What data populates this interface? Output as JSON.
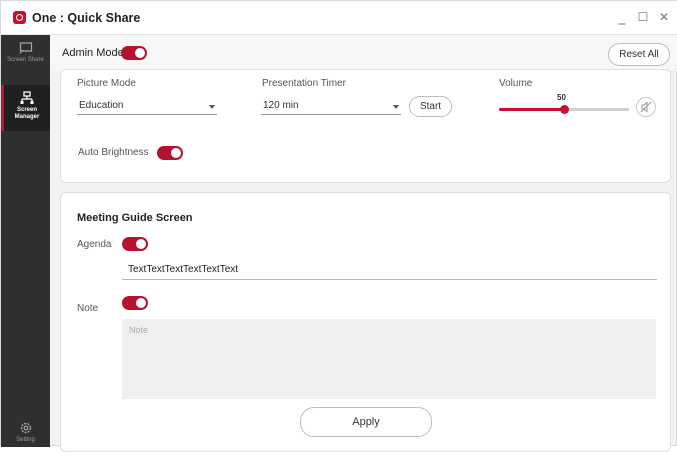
{
  "window": {
    "title": "One : Quick Share",
    "minimize": "_",
    "maximize": "☐",
    "close": "✕"
  },
  "sidebar": {
    "items": [
      {
        "label": "Screen Share",
        "icon": "screen-share-icon"
      },
      {
        "label": "Screen Manager",
        "icon": "network-icon"
      }
    ],
    "bottom": {
      "icon": "settings-icon",
      "label": "Setting"
    }
  },
  "admin": {
    "label": "Admin Mode",
    "enabled": true,
    "reset_label": "Reset All"
  },
  "settings": {
    "picture_mode": {
      "label": "Picture Mode",
      "value": "Education"
    },
    "presentation_timer": {
      "label": "Presentation Timer",
      "value": "120 min",
      "start_label": "Start"
    },
    "volume": {
      "label": "Volume",
      "value": "50",
      "level": 0.5,
      "mute_icon": "mute-icon"
    },
    "auto_brightness": {
      "label": "Auto Brightness",
      "enabled": true
    }
  },
  "meeting_guide": {
    "title": "Meeting Guide Screen",
    "agenda": {
      "label": "Agenda",
      "enabled": true,
      "value": "TextTextTextTextTextText"
    },
    "note": {
      "label": "Note",
      "enabled": true,
      "placeholder": "Note"
    }
  },
  "apply_label": "Apply",
  "colors": {
    "accent": "#c8102e",
    "sidebar": "#2d2f31"
  }
}
